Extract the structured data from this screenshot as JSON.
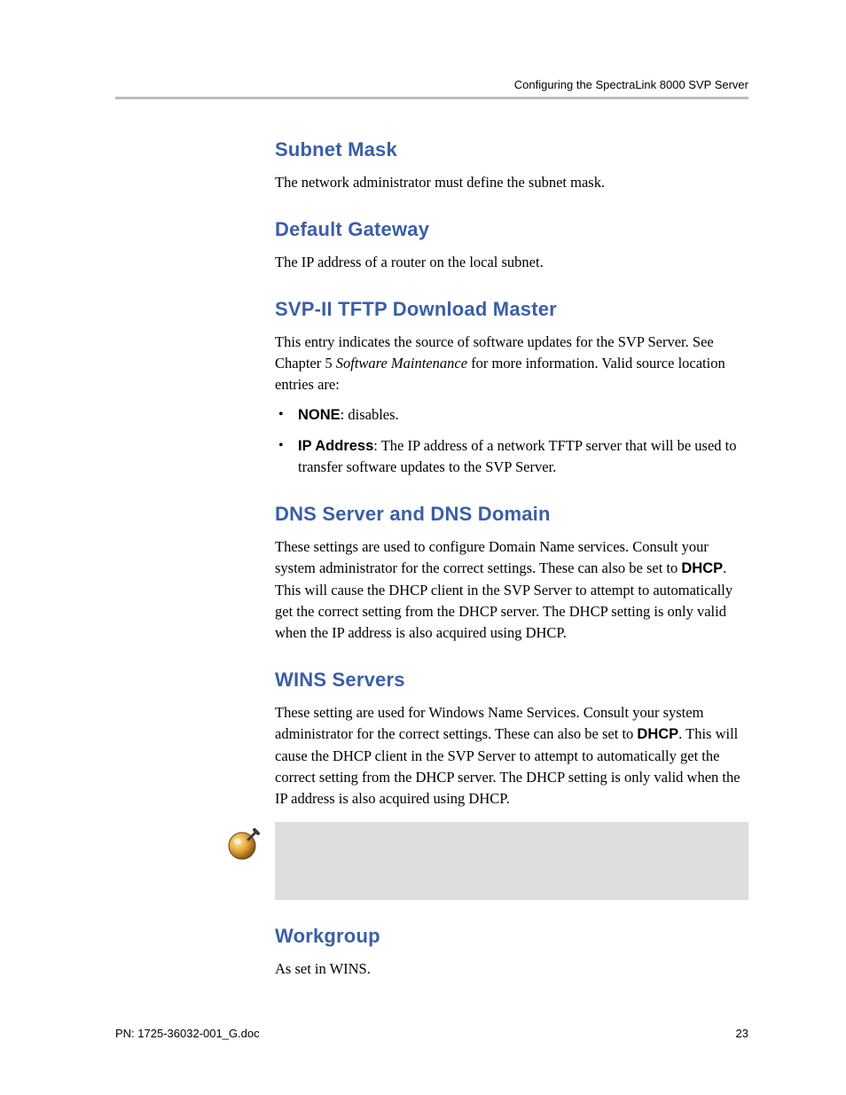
{
  "running_head": "Configuring the SpectraLink 8000 SVP Server",
  "sections": {
    "subnet_mask": {
      "heading": "Subnet Mask",
      "body": "The network administrator must define the subnet mask."
    },
    "default_gateway": {
      "heading": "Default Gateway",
      "body": "The IP address of a router on the local subnet."
    },
    "tftp": {
      "heading": "SVP-II TFTP Download Master",
      "body_pre": "This entry indicates the source of software updates for the SVP Server. See Chapter 5 ",
      "body_em": "Software Maintenance",
      "body_post": " for more information. Valid source location entries are:",
      "bullet1_bold": "NONE",
      "bullet1_rest": ": disables.",
      "bullet2_bold": "IP Address",
      "bullet2_rest": ": The IP address of a network TFTP server that will be used to transfer software updates to the SVP Server."
    },
    "dns": {
      "heading": "DNS Server and DNS Domain",
      "body_pre": "These settings are used to configure Domain Name services. Consult your system administrator for the correct settings. These can also be set to ",
      "body_bold": "DHCP",
      "body_post": ". This will cause the DHCP client in the SVP Server to attempt to automatically get the correct setting from the DHCP server. The DHCP setting is only valid when the IP address is also acquired using DHCP."
    },
    "wins": {
      "heading": "WINS Servers",
      "body_pre": "These setting are used for Windows Name Services. Consult your system administrator for the correct settings. These can also be set to ",
      "body_bold": "DHCP",
      "body_post": ". This will cause the DHCP client in the SVP Server to attempt to automatically get the correct setting from the DHCP server. The DHCP setting is only valid when the IP address is also acquired using DHCP."
    },
    "workgroup": {
      "heading": "Workgroup",
      "body": "As set in WINS."
    }
  },
  "footer": {
    "left": "PN: 1725-36032-001_G.doc",
    "right": "23"
  }
}
